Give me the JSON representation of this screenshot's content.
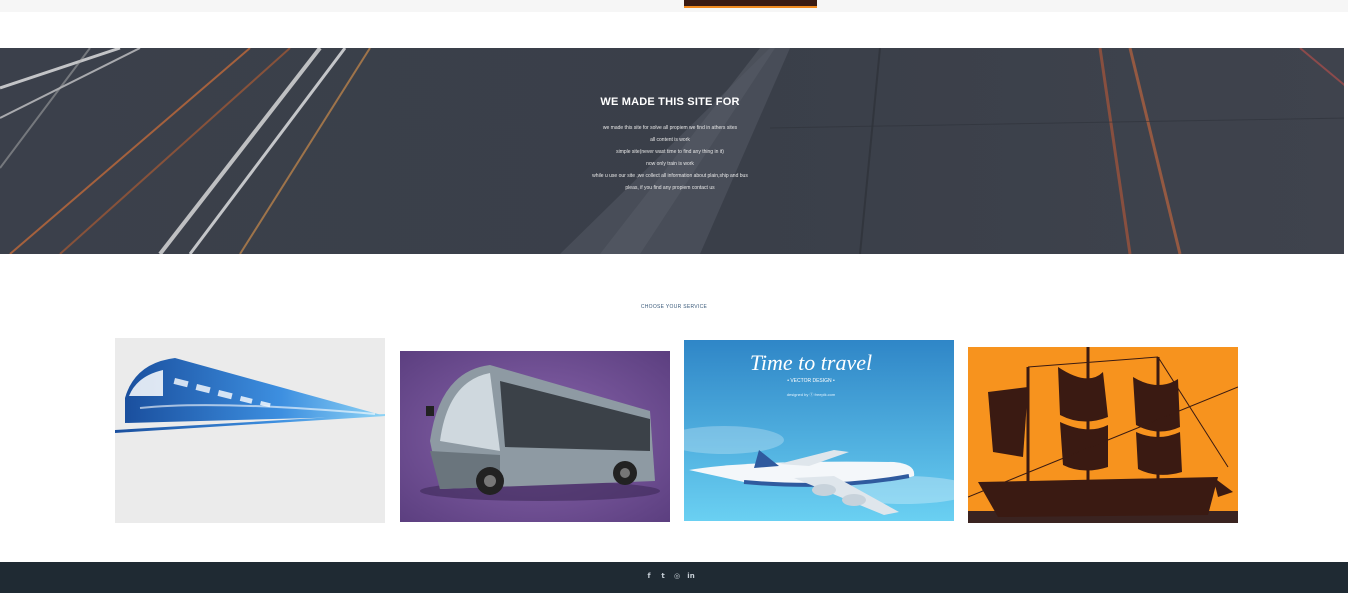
{
  "hero": {
    "title": "WE MADE THIS SITE FOR",
    "lines": [
      "we made this site for solve all propiem we find in athers sites",
      "all content is work",
      "simple site(never wast time to find any thing in it)",
      "now only train is work",
      "while u use our site ,we collect all information about plain,ship and bus",
      "pleas, if you find any propiem contact us"
    ]
  },
  "services": {
    "title": "CHOOSE YOUR SERVICE",
    "cards": [
      {
        "name": "train",
        "label": ""
      },
      {
        "name": "bus",
        "label": ""
      },
      {
        "name": "plane",
        "label": "Time to travel",
        "sublabel": "• VECTOR DESIGN •",
        "credit": "designed by ⓕ freepik.com"
      },
      {
        "name": "ship",
        "label": ""
      }
    ]
  },
  "footer": {
    "social": [
      {
        "icon": "facebook-icon",
        "glyph": "f"
      },
      {
        "icon": "twitter-icon",
        "glyph": "t"
      },
      {
        "icon": "instagram-icon",
        "glyph": "◎"
      },
      {
        "icon": "linkedin-icon",
        "glyph": "in"
      }
    ]
  },
  "colors": {
    "footer_bg": "#1f2a33",
    "ship_bg": "#f7931e",
    "bus_bg": "#6b4a8c",
    "plane_bg": "#3a9bd0",
    "train_bg": "#ebebeb"
  }
}
